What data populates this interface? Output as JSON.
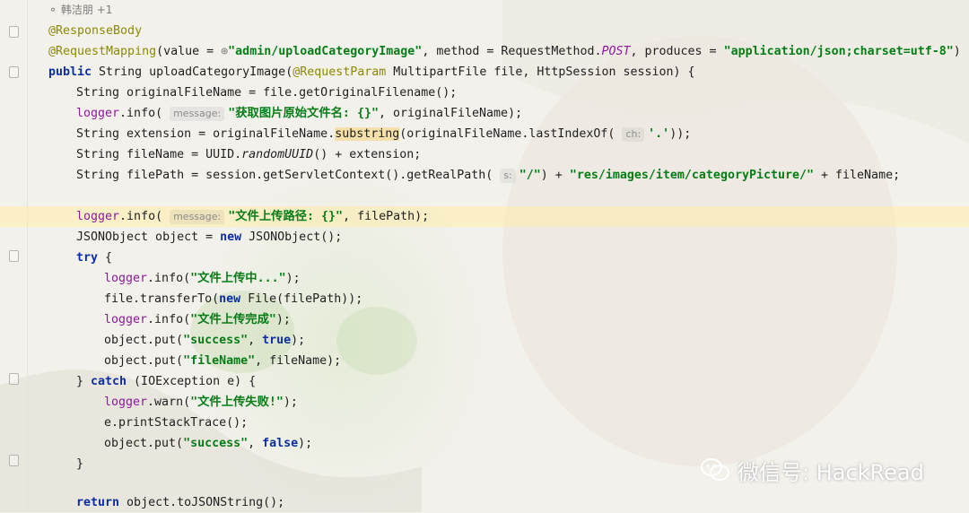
{
  "author": {
    "icon": "user-icon",
    "text": "韩洁朋 +1"
  },
  "code": {
    "l1": "@ResponseBody",
    "l2": {
      "a": "@RequestMapping",
      "b": "(value = ",
      "c": "\"admin/uploadCategoryImage\"",
      "d": ", method = RequestMethod.",
      "e": "POST",
      "f": ", produces = ",
      "g": "\"application/json;charset=utf-8\"",
      "h": ")"
    },
    "l3": {
      "a": "public",
      "b": " String uploadCategoryImage(",
      "c": "@RequestParam",
      "d": " MultipartFile file, HttpSession session) {"
    },
    "l4": "String originalFileName = file.getOriginalFilename();",
    "l5": {
      "a": "logger",
      "b": ".info( ",
      "hint": "message:",
      "c": "\"获取图片原始文件名: {}\"",
      "d": ", originalFileName);"
    },
    "l6": {
      "a": "String extension = originalFileName.",
      "b": "substring",
      "c": "(originalFileName.lastIndexOf( ",
      "hint": "ch:",
      "d": "'.'",
      "e": "));"
    },
    "l7": {
      "a": "String fileName = UUID.",
      "b": "randomUUID",
      "c": "() + extension;"
    },
    "l8": {
      "a": "String filePath = session.getServletContext().getRealPath( ",
      "hint": "s:",
      "b": "\"/\"",
      "c": ") + ",
      "d": "\"res/images/item/categoryPicture/\"",
      "e": " + fileName;"
    },
    "l10": {
      "a": "logger",
      "b": ".info( ",
      "hint": "message:",
      "c": "\"文件上传路径: {}\"",
      "d": ", filePath);"
    },
    "l11": {
      "a": "JSONObject object = ",
      "b": "new",
      "c": " JSONObject();"
    },
    "l12": {
      "a": "try",
      "b": " {"
    },
    "l13": {
      "a": "logger",
      "b": ".info(",
      "c": "\"文件上传中...\"",
      "d": ");"
    },
    "l14": {
      "a": "file.transferTo(",
      "b": "new",
      "c": " File(filePath));"
    },
    "l15": {
      "a": "logger",
      "b": ".info(",
      "c": "\"文件上传完成\"",
      "d": ");"
    },
    "l16": {
      "a": "object.put(",
      "b": "\"success\"",
      "c": ", ",
      "d": "true",
      "e": ");"
    },
    "l17": {
      "a": "object.put(",
      "b": "\"fileName\"",
      "c": ", fileName);"
    },
    "l18": {
      "a": "} ",
      "b": "catch",
      "c": " (IOException e) {"
    },
    "l19": {
      "a": "logger",
      "b": ".warn(",
      "c": "\"文件上传失败!\"",
      "d": ");"
    },
    "l20": "e.printStackTrace();",
    "l21": {
      "a": "object.put(",
      "b": "\"success\"",
      "c": ", ",
      "d": "false",
      "e": ");"
    },
    "l22": "}",
    "l24": {
      "a": "return",
      "b": " object.toJSONString();"
    }
  },
  "watermark": {
    "icon": "wechat-icon",
    "text": "微信号: HackRead"
  }
}
